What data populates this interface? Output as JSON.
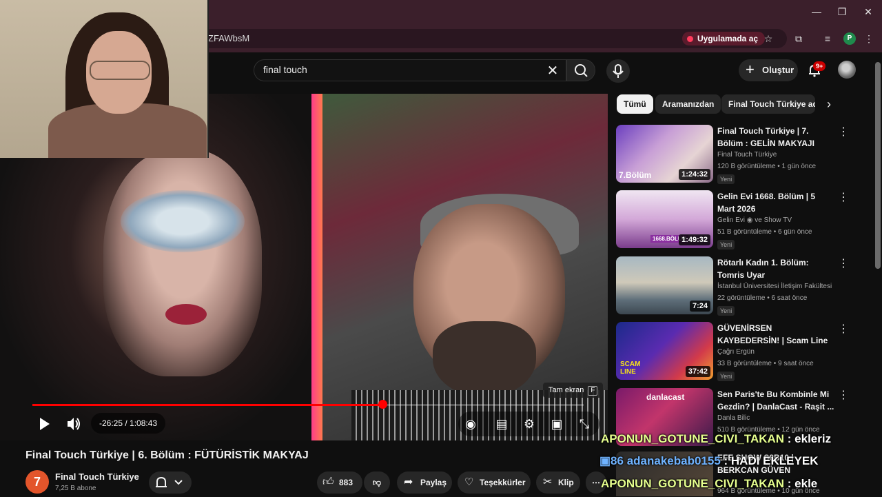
{
  "browser": {
    "url_fragment": "ZFAWbsM",
    "open_in_app": "Uygulamada aç",
    "profile_initial": "P"
  },
  "search": {
    "query": "final touch"
  },
  "header": {
    "create_label": "Oluştur",
    "notif_count": "9+"
  },
  "player": {
    "time": "-26:25 / 1:08:43",
    "progress": 0.635,
    "tooltip_label": "Tam ekran",
    "tooltip_key": "F"
  },
  "video": {
    "title": "Final Touch Türkiye | 6. Bölüm : FÜTÜRİSTİK MAKYAJ",
    "channel": "Final Touch Türkiye",
    "subscribers": "7,25 B abone",
    "likes": "883",
    "share": "Paylaş",
    "thanks": "Teşekkürler",
    "clip": "Klip"
  },
  "chips": [
    "Tümü",
    "Aramanızdan",
    "Final Touch Türkiye adlı"
  ],
  "recommendations": [
    {
      "title": "Final Touch Türkiye | 7. Bölüm : GELİN MAKYAJI",
      "channel": "Final Touch Türkiye",
      "meta": "120 B görüntüleme • 1 gün önce",
      "badge": "Yeni",
      "duration": "1:24:32",
      "thumb_label": "7.Bölüm"
    },
    {
      "title": "Gelin Evi 1668. Bölüm | 5 Mart 2026",
      "channel": "Gelin Evi ◉ ve Show TV",
      "meta": "51 B görüntüleme • 6 gün önce",
      "badge": "Yeni",
      "duration": "1:49:32",
      "thumb_label": "1668.BÖLÜM"
    },
    {
      "title": "Rötarlı Kadın 1. Bölüm: Tomris Uyar",
      "channel": "İstanbul Üniversitesi İletişim Fakültesi",
      "meta": "22 görüntüleme • 6 saat önce",
      "badge": "Yeni",
      "duration": "7:24",
      "thumb_label": ""
    },
    {
      "title": "GÜVENİRSEN KAYBEDERSİN! | Scam Line",
      "channel": "Çağrı Ergün",
      "meta": "33 B görüntüleme • 9 saat önce",
      "badge": "Yeni",
      "duration": "37:42",
      "thumb_label": "SCAM LINE"
    },
    {
      "title": "Sen Paris'te Bu Kombinle Mi Gezdin? | DanlaCast - Raşit ...",
      "channel": "Danla Bilic",
      "meta": "510 B görüntüleme • 12 gün önce",
      "badge": "",
      "duration": "",
      "thumb_label": "danlacast"
    },
    {
      "title": "EFE SHOW S8B10 | BERKCAN GÜVEN",
      "channel": "",
      "meta": "964 B görüntüleme • 10 gün önce",
      "badge": "",
      "duration": "",
      "thumb_label": ""
    }
  ],
  "chat": [
    {
      "user": "APONUN_GOTUNE_CIVI_TAKAN",
      "message": " : ekleriz"
    },
    {
      "user": "adanakebab0155",
      "message": " : HADİ EKLEYEK"
    },
    {
      "user": "APONUN_GOTUNE_CIVI_TAKAN",
      "message": " : ekle"
    }
  ],
  "colors": {
    "accent": "#ff0000",
    "chrome": "#3b1f2b",
    "chat": "#e6ff8e",
    "chat_user2": "#6fb3ff"
  }
}
